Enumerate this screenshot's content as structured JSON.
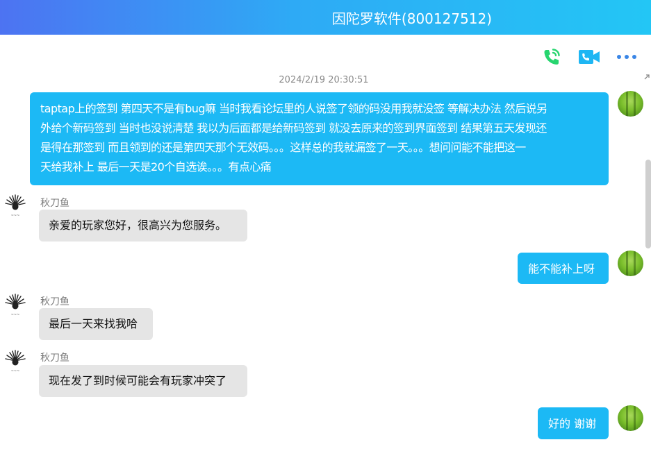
{
  "header": {
    "title": "因陀罗软件(800127512)",
    "gradient": [
      "#4d73f2",
      "#23c6f5"
    ]
  },
  "toolbar": {
    "icons": [
      "phone-call-icon",
      "video-call-icon",
      "more-options-icon"
    ],
    "phone_color": "#27d56f",
    "video_color": "#1eb6f3",
    "more_color": "#3a86e6"
  },
  "timestamp": "2024/2/19 20:30:51",
  "messages": [
    {
      "side": "self",
      "lines": [
        "taptap上的签到 第四天不是有bug嘛 当时我看论坛里的人说签了领的码没用我就没签 等解决办法 然后说另",
        "外给个新码签到 当时也没说清楚 我以为后面都是给新码签到 就没去原来的签到界面签到 结果第五天发现还",
        "是得在那签到 而且领到的还是第四天那个无效码。。。这样总的我就漏签了一天。。。想问问能不能把这一",
        "天给我补上 最后一天是20个自选诶。。。有点心痛"
      ]
    },
    {
      "side": "agent",
      "sender": "秋刀鱼",
      "text": "亲爱的玩家您好，很高兴为您服务。"
    },
    {
      "side": "self",
      "text": "能不能补上呀"
    },
    {
      "side": "agent",
      "sender": "秋刀鱼",
      "text": "最后一天来找我哈"
    },
    {
      "side": "agent",
      "sender": "秋刀鱼",
      "text": "现在发了到时候可能会有玩家冲突了"
    },
    {
      "side": "self",
      "text": "好的 谢谢"
    }
  ],
  "colors": {
    "self_bubble": "#1cb9f5",
    "agent_bubble": "#e5e5e5",
    "timestamp": "#8a8a8a"
  }
}
